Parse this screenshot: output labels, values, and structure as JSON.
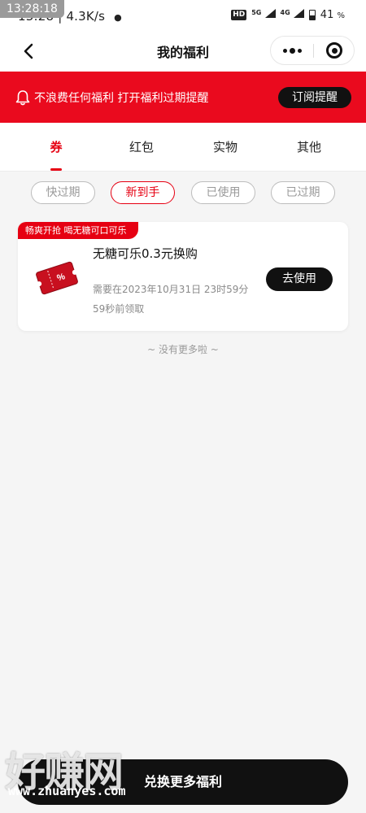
{
  "status_bar": {
    "time_badge": "13:28:18",
    "time": "13:28",
    "speed": "4.3K/s",
    "hd": "HD",
    "net1": "5G",
    "net2": "4G",
    "battery": "41",
    "percent": "%"
  },
  "nav": {
    "title": "我的福利"
  },
  "notice": {
    "text": "不浪费任何福利 打开福利过期提醒",
    "subscribe_label": "订阅提醒"
  },
  "tabs": [
    {
      "label": "券",
      "active": true
    },
    {
      "label": "红包",
      "active": false
    },
    {
      "label": "实物",
      "active": false
    },
    {
      "label": "其他",
      "active": false
    }
  ],
  "filters": [
    {
      "label": "快过期",
      "active": false
    },
    {
      "label": "新到手",
      "active": true
    },
    {
      "label": "已使用",
      "active": false
    },
    {
      "label": "已过期",
      "active": false
    }
  ],
  "coupon": {
    "tag": "畅爽开抢 喝无糖可口可乐",
    "title": "无糖可乐0.3元换购",
    "expiry": "需要在2023年10月31日 23时59分",
    "received": "59秒前领取",
    "use_label": "去使用",
    "icon_symbol": "%"
  },
  "list_end": "~ 没有更多啦 ~",
  "footer": {
    "redeem_label": "兑换更多福利"
  },
  "watermark": {
    "text": "好赚网",
    "url": "www.zhuanyes.com"
  },
  "colors": {
    "brand_red": "#ea0a1e",
    "accent_red": "#e60012",
    "dark": "#111111"
  }
}
